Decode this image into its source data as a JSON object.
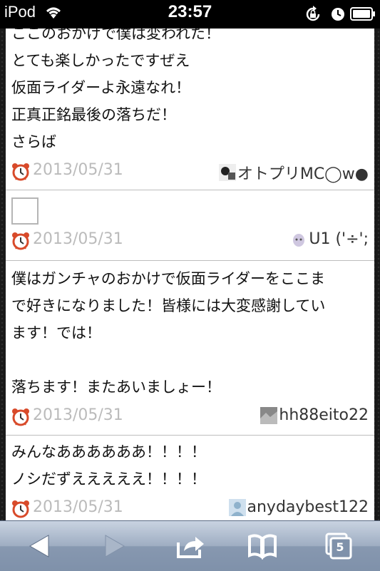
{
  "status_bar": {
    "carrier": "iPod",
    "time": "23:57"
  },
  "posts": [
    {
      "lines": [
        "ここのおかげで僕は変われた！",
        "とても楽しかったですぜえ",
        "仮面ライダーよ永遠なれ！",
        "正真正銘最後の落ちだ！",
        "さらば"
      ],
      "date": "2013/05/31",
      "user": "オトプリMC◯w●"
    },
    {
      "lines": [],
      "date": "2013/05/31",
      "user": "U1 ('÷';"
    },
    {
      "lines": [
        "僕はガンチャのおかけで仮面ライダーをここま",
        "で好きになりました！皆様には大変感謝してい",
        "ます！では！",
        "",
        "落ちます！またあいましょー！"
      ],
      "date": "2013/05/31",
      "user": "hh88eito22"
    },
    {
      "lines": [
        "みんなああああああ！！！！",
        "ノシだずえええええ！！！！"
      ],
      "date": "2013/05/31",
      "user": "anydaybest122"
    }
  ],
  "toolbar": {
    "tab_count": "5"
  },
  "icons": {
    "back": "back-arrow-icon",
    "forward": "forward-arrow-icon",
    "share": "share-icon",
    "bookmarks": "bookmarks-book-icon",
    "tabs": "tabs-icon"
  }
}
